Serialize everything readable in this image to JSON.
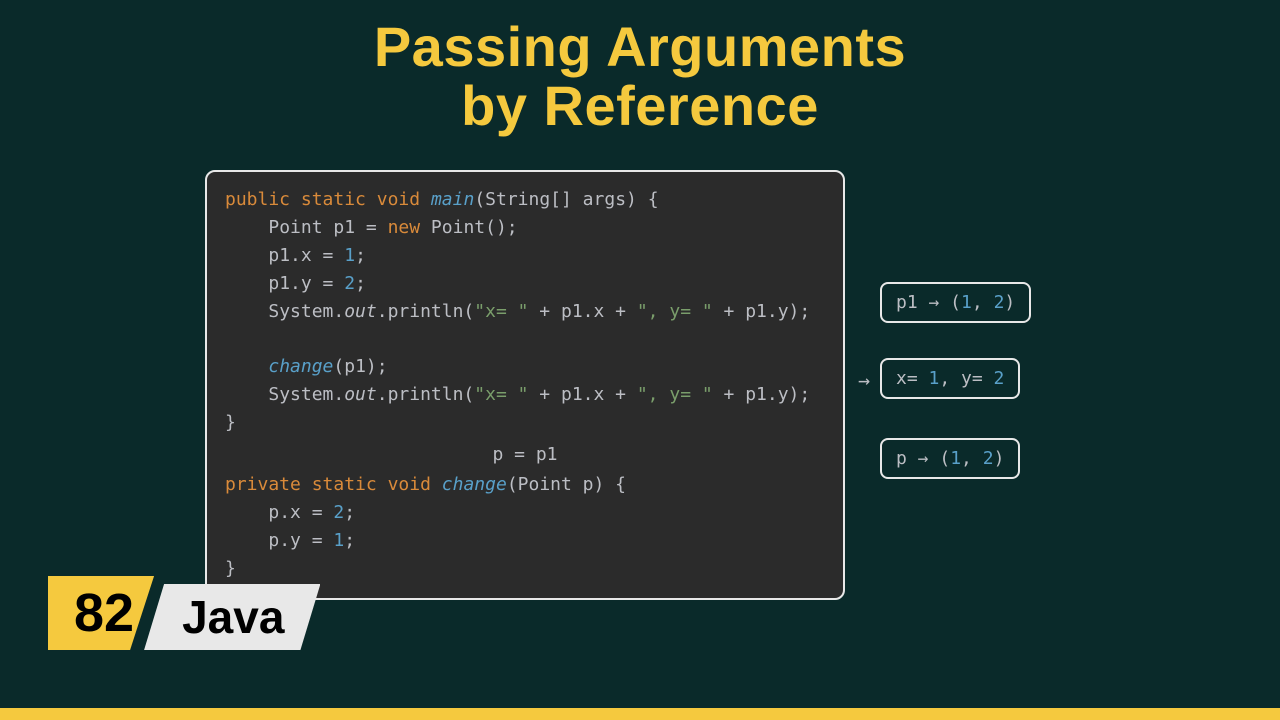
{
  "title_line1": "Passing Arguments",
  "title_line2": "by Reference",
  "code_note": "p = p1",
  "side": {
    "p1": {
      "label": "p1 → (",
      "a": "1",
      "comma": ", ",
      "b": "2",
      "close": ")"
    },
    "out": {
      "pre1": "x= ",
      "v1": "1",
      "mid": ", y= ",
      "v2": "2"
    },
    "p": {
      "label": "p → (",
      "a": "1",
      "comma": ", ",
      "b": "2",
      "close": ")"
    },
    "arrow": "→"
  },
  "badge": {
    "num": "82",
    "lang": "Java"
  },
  "tokens": {
    "public": "public",
    "static": "static",
    "void": "void",
    "main": "main",
    "sigopen": "(String[] args) {",
    "point": "Point",
    "p1decl": " p1 = ",
    "new": "new",
    "pointctor": " Point();",
    "setx": "p1.x = ",
    "one": "1",
    "semi": ";",
    "sety": "p1.y = ",
    "two": "2",
    "sysout": "System.",
    "out": "out",
    "println": ".println(",
    "s1": "\"x= \"",
    "plus": " + p1.x + ",
    "s2": "\", y= \"",
    "plus2": " + p1.y);",
    "change": "change",
    "cp1": "(p1);",
    "close": "}",
    "private": "private",
    "changesig": "(Point p) {",
    "px": "p.x = ",
    "py": "p.y = "
  }
}
